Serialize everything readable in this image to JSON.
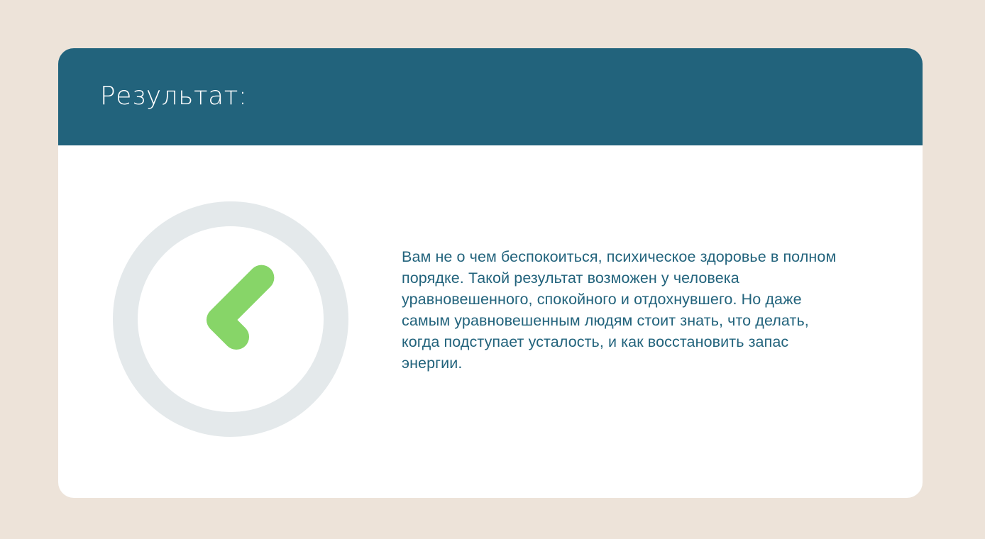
{
  "card": {
    "title": "Результат:",
    "icon": "check-circle-icon",
    "message": "Вам не о чем беспокоиться, психическое здоровье в полном порядке. Такой результат возможен у человека уравновешенного, спокойного и отдохнувшего. Но даже самым уравновешенным людям стоит знать, что делать, когда подступает усталость, и как восстановить запас энергии."
  },
  "colors": {
    "page_background": "#ede3d9",
    "header": "#22637c",
    "card": "#ffffff",
    "ring": "#e4e9eb",
    "check": "#87d568",
    "text": "#22637c"
  }
}
